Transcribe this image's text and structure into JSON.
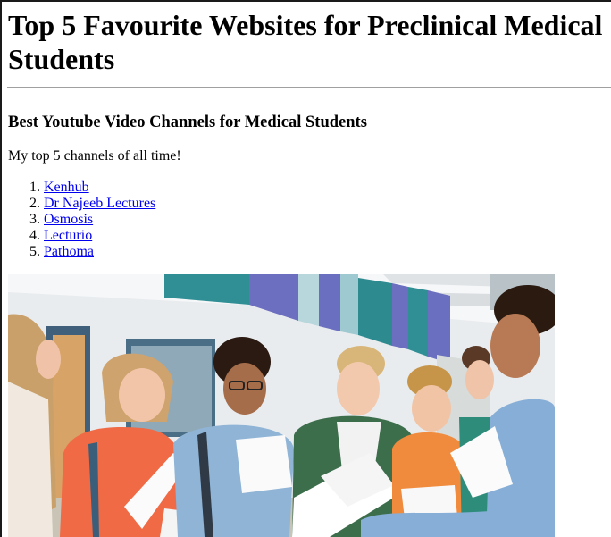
{
  "page": {
    "title": "Top 5 Favourite Websites for Preclinical Medical Students",
    "section_heading": "Best Youtube Video Channels for Medical Students",
    "intro": "My top 5 channels of all time!",
    "channels": [
      {
        "number": "1.",
        "label": "Kenhub"
      },
      {
        "number": "2.",
        "label": "Dr Najeeb Lectures"
      },
      {
        "number": "3.",
        "label": "Osmosis"
      },
      {
        "number": "4.",
        "label": "Lecturio"
      },
      {
        "number": "5.",
        "label": "Pathoma"
      }
    ]
  },
  "colors": {
    "link": "#0000ee",
    "text": "#000000",
    "background": "#ffffff"
  },
  "photo": {
    "subject": "group of students reading exam result papers in a school corridor"
  }
}
